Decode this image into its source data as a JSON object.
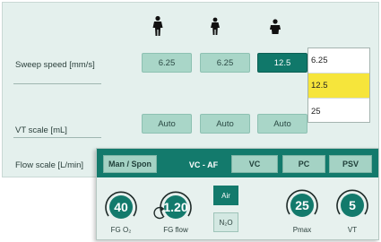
{
  "patient_icons": [
    "adult-icon",
    "child-icon",
    "infant-icon"
  ],
  "rows": [
    {
      "label": "Sweep speed [mm/s]",
      "buttons": [
        "6.25",
        "6.25",
        "12.5"
      ],
      "selected_index": 2
    },
    {
      "label": "VT scale [mL]",
      "buttons": [
        "Auto",
        "Auto",
        "Auto"
      ]
    },
    {
      "label": "Flow scale [L/min]"
    }
  ],
  "dropdown": {
    "options": [
      "6.25",
      "12.5",
      "25"
    ],
    "highlighted_index": 1
  },
  "mode_tabs": [
    "Man / Spon",
    "VC - AF",
    "VC",
    "PC",
    "PSV"
  ],
  "active_tab_index": 1,
  "knobs": [
    {
      "value": "40",
      "label": "FG O₂"
    },
    {
      "value": "1.20",
      "label": "FG flow"
    },
    {
      "value": "25",
      "label": "Pmax"
    },
    {
      "value": "5",
      "label": "VT"
    }
  ],
  "gas_buttons": [
    "Air",
    "N₂O"
  ],
  "colors": {
    "accent": "#137a6c",
    "button": "#a9d6c8",
    "panel": "#e4f0ed",
    "highlight": "#f6e53b"
  }
}
